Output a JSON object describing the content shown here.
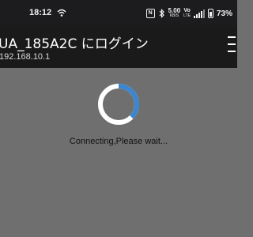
{
  "status_bar": {
    "time": "18:12",
    "speed_value": "5.00",
    "speed_unit": "KB/S",
    "volte_top": "Vo",
    "volte_bottom": "LTE",
    "battery": "73%",
    "icons": [
      "wifi-icon",
      "nfc-icon",
      "bluetooth-icon",
      "signal-icon",
      "battery-icon"
    ]
  },
  "header": {
    "title": "UA_185A2C にログイン",
    "subtitle": "192.168.10.1",
    "menu_icon": "menu-icon"
  },
  "loading": {
    "message": "Connecting,Please wait..."
  },
  "colors": {
    "status_bar_bg": "#1c1c1e",
    "header_bg": "#1a1a1a",
    "content_bg": "#6f6f6f",
    "spinner_track": "#ffffff",
    "spinner_accent": "#3a86d0"
  }
}
